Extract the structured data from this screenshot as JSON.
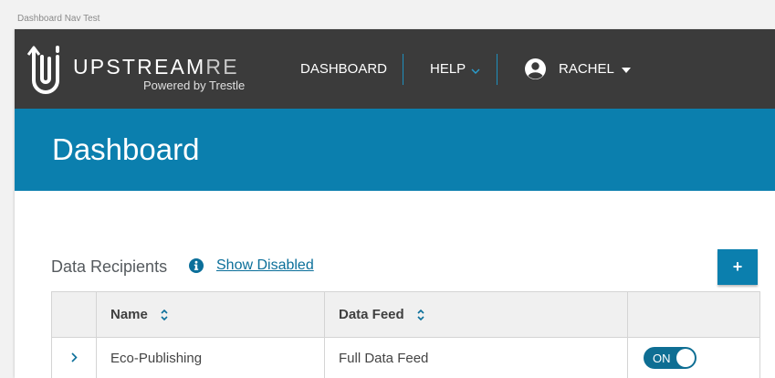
{
  "window": {
    "title": "Dashboard Nav Test"
  },
  "brand": {
    "name_main": "UPSTREAM",
    "name_suffix": "RE",
    "tagline": "Powered by Trestle"
  },
  "nav": {
    "dashboard_label": "DASHBOARD",
    "help_label": "HELP",
    "user_label": "RACHEL"
  },
  "header": {
    "title": "Dashboard"
  },
  "section": {
    "title": "Data Recipients",
    "show_disabled_label": "Show Disabled",
    "add_label": "+"
  },
  "table": {
    "columns": [
      "",
      "Name",
      "Data Feed",
      ""
    ],
    "rows": [
      {
        "name": "Eco-Publishing",
        "data_feed": "Full Data Feed",
        "enabled_label": "ON"
      }
    ]
  },
  "colors": {
    "nav_bg": "#3b3b3b",
    "accent": "#0b7fae",
    "link": "#0b6f9a",
    "toggle_on": "#0e6e93"
  },
  "icons": {
    "logo": "upstream-logo-icon",
    "help_caret": "chevron-down-icon",
    "avatar": "user-avatar-icon",
    "user_caret": "caret-down-icon",
    "info": "info-icon",
    "sort": "sort-icon",
    "expand": "chevron-right-icon"
  }
}
